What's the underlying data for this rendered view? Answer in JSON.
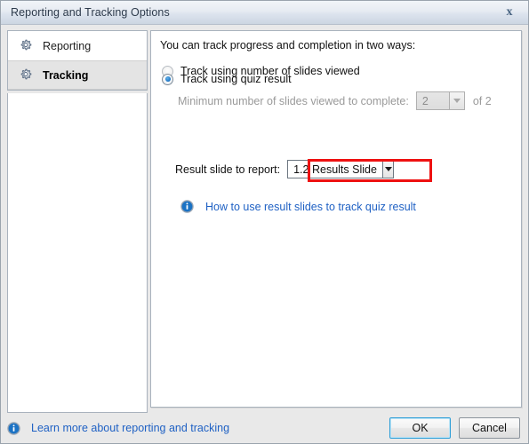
{
  "window": {
    "title": "Reporting and Tracking Options",
    "close_icon": "close-x-icon"
  },
  "sidebar": {
    "items": [
      {
        "label": "Reporting",
        "icon": "gear-icon",
        "selected": false
      },
      {
        "label": "Tracking",
        "icon": "gear-icon",
        "selected": true
      }
    ]
  },
  "content": {
    "intro": "You can track progress and completion in two ways:",
    "option_slides": {
      "label": "Track using number of slides viewed",
      "selected": false,
      "sub_label": "Minimum number of slides viewed to complete:",
      "spinner_value": "2",
      "spinner_enabled": false,
      "total_label": "of 2",
      "caret_icon": "chevron-down-icon"
    },
    "option_quiz": {
      "label": "Track using quiz result",
      "selected": true,
      "highlight_color": "#ee1111",
      "sub_label": "Result slide to report:",
      "dropdown_value": "1.2 Results Slide",
      "dropdown_enabled": true,
      "caret_icon": "chevron-down-icon"
    },
    "help": {
      "icon": "info-icon",
      "link_text": "How to use result slides to track quiz result",
      "link_color": "#1f61c4"
    }
  },
  "footer": {
    "info_icon": "info-icon",
    "link_text": "Learn more about reporting and tracking",
    "ok_label": "OK",
    "cancel_label": "Cancel",
    "focus_color": "#2e9fd8"
  }
}
